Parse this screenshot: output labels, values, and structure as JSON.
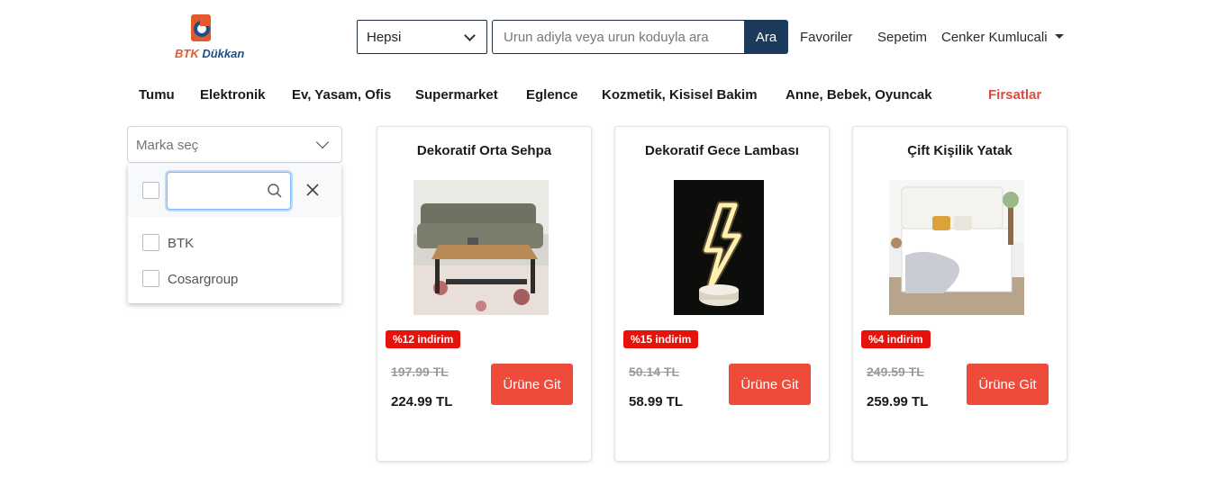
{
  "header": {
    "logo_text_a": "BTK",
    "logo_text_b": "Dükkan",
    "category_select_value": "Hepsi",
    "search_placeholder": "Urun adiyla veya urun koduyla ara",
    "search_button": "Ara",
    "favorites": "Favoriler",
    "cart": "Sepetim",
    "user": "Cenker Kumlucali"
  },
  "categories": [
    "Tumu",
    "Elektronik",
    "Ev, Yasam, Ofis",
    "Supermarket",
    "Eglence",
    "Kozmetik, Kisisel Bakim",
    "Anne, Bebek, Oyuncak",
    "Firsatlar"
  ],
  "brand_filter": {
    "placeholder": "Marka seç",
    "options": [
      "BTK",
      "Cosargroup"
    ]
  },
  "products": [
    {
      "title": "Dekoratif Orta Sehpa",
      "discount": "%12 indirim",
      "old_price": "197.99 TL",
      "price": "224.99 TL",
      "button": "Ürüne Git"
    },
    {
      "title": "Dekoratif Gece Lambası",
      "discount": "%15 indirim",
      "old_price": "50.14 TL",
      "price": "58.99 TL",
      "button": "Ürüne Git"
    },
    {
      "title": "Çift Kişilik Yatak",
      "discount": "%4 indirim",
      "old_price": "249.59 TL",
      "price": "259.99 TL",
      "button": "Ürüne Git"
    }
  ],
  "colors": {
    "navy": "#1b3a5c",
    "accent_red": "#ee4b3b",
    "badge_red": "#e8120c",
    "deals_red": "#e0493b"
  }
}
